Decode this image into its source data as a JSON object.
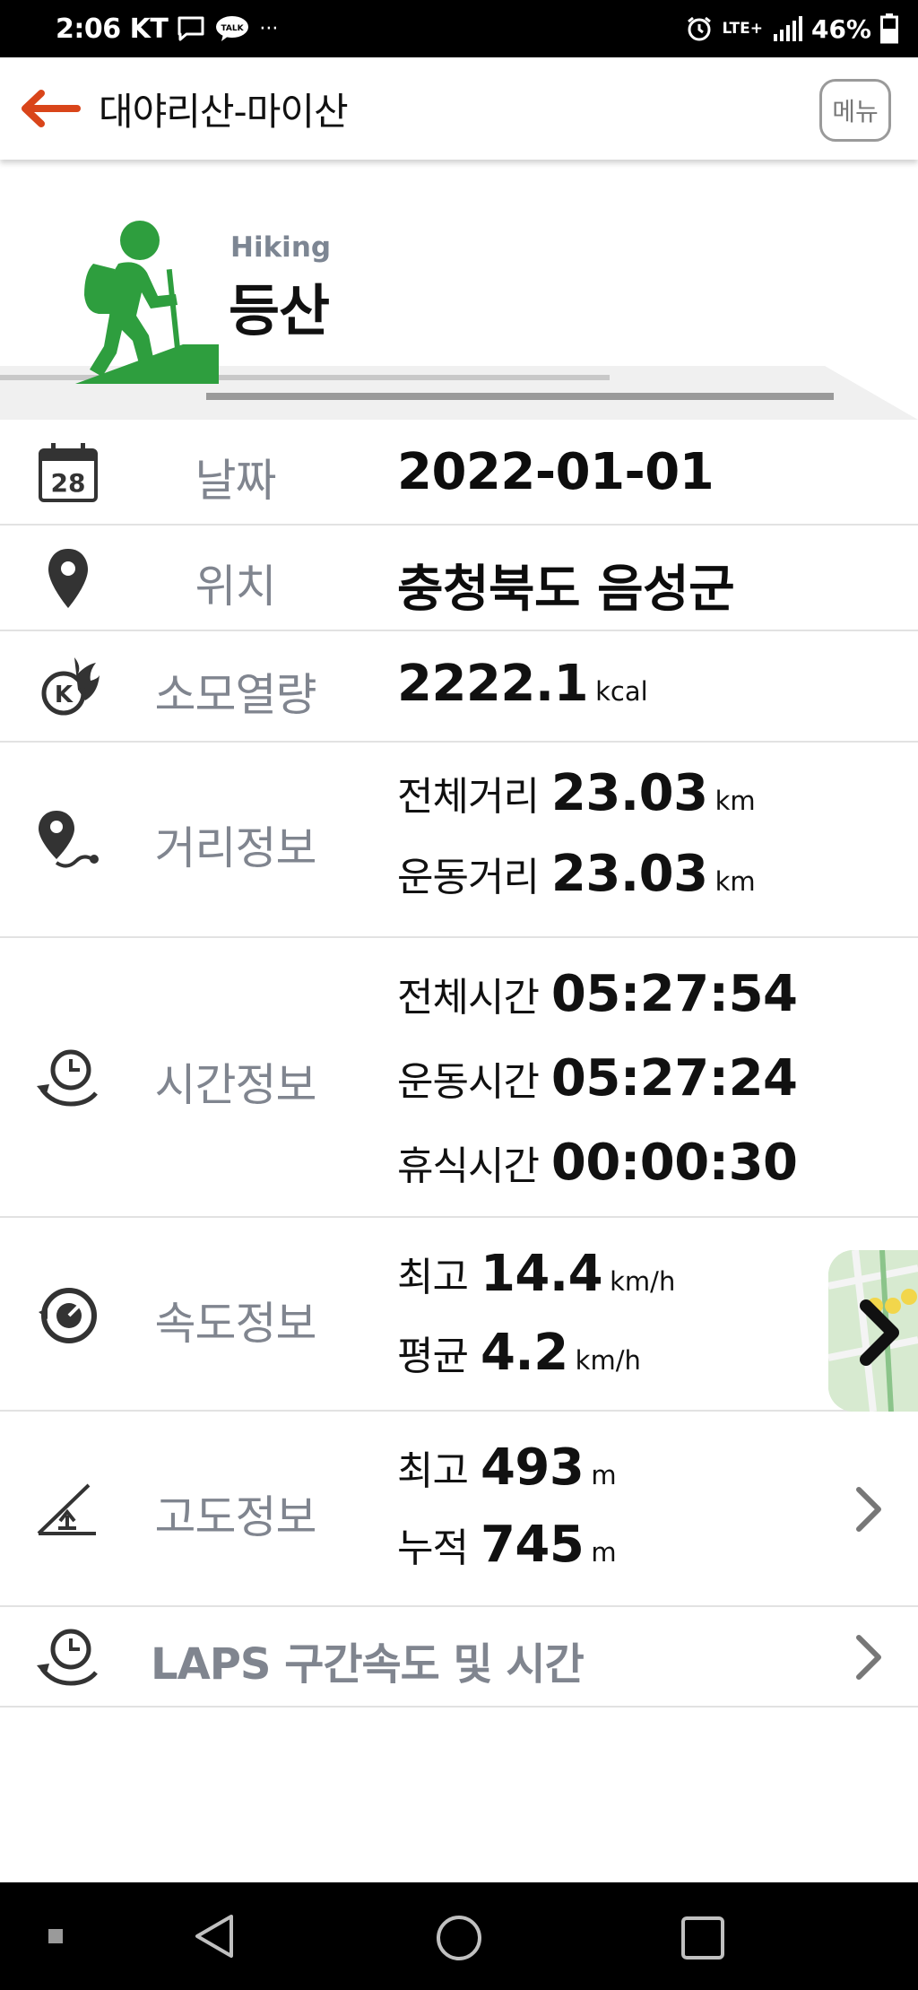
{
  "status_bar": {
    "time": "2:06",
    "carrier": "KT",
    "talk": "TALK",
    "more": "···",
    "network": "LTE+",
    "battery": "46%"
  },
  "header": {
    "title": "대야리산-마이산",
    "menu_label": "메뉴"
  },
  "hero": {
    "sub": "Hiking",
    "title": "등산"
  },
  "calendar_day": "28",
  "calorie_badge": "K",
  "rows": {
    "date": {
      "label": "날짜",
      "value": "2022-01-01"
    },
    "location": {
      "label": "위치",
      "value": "충청북도 음성군"
    },
    "calories": {
      "label": "소모열량",
      "value": "2222.1",
      "unit": "kcal"
    },
    "distance": {
      "label": "거리정보",
      "total_label": "전체거리",
      "total_value": "23.03",
      "total_unit": "km",
      "move_label": "운동거리",
      "move_value": "23.03",
      "move_unit": "km"
    },
    "time": {
      "label": "시간정보",
      "total_label": "전체시간",
      "total_value": "05:27:54",
      "move_label": "운동시간",
      "move_value": "05:27:24",
      "rest_label": "휴식시간",
      "rest_value": "00:00:30"
    },
    "speed": {
      "label": "속도정보",
      "max_label": "최고",
      "max_value": "14.4",
      "max_unit": "km/h",
      "avg_label": "평균",
      "avg_value": "4.2",
      "avg_unit": "km/h"
    },
    "altitude": {
      "label": "고도정보",
      "max_label": "최고",
      "max_value": "493",
      "max_unit": "m",
      "cum_label": "누적",
      "cum_value": "745",
      "cum_unit": "m"
    },
    "laps": {
      "label": "LAPS 구간속도 및 시간"
    }
  },
  "colors": {
    "accent_back": "#d9451a",
    "hiker_green": "#2e9e3e",
    "label_gray": "#80858f"
  }
}
